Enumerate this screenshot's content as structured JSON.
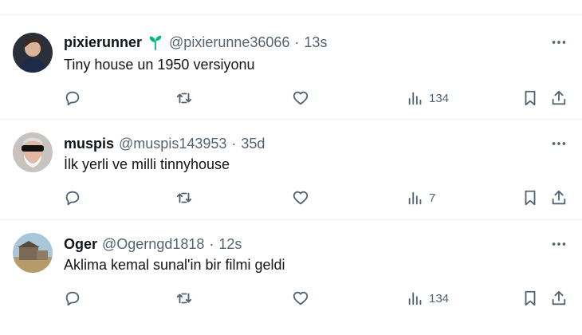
{
  "tweets": [
    {
      "name": "pixierunner",
      "handle": "@pixierunne36066",
      "separator": "·",
      "time": "13s",
      "text": "Tiny house un 1950 versiyonu",
      "views": "134",
      "has_badge": true,
      "badge_icon": "sprout-icon"
    },
    {
      "name": "muspis",
      "handle": "@muspis143953",
      "separator": "·",
      "time": "35d",
      "text": "İlk yerli ve milli tinnyhouse",
      "views": "7"
    },
    {
      "name": "Oger",
      "handle": "@Ogerngd1818",
      "separator": "·",
      "time": "12s",
      "text": "Aklima kemal sunal'in bir filmi geldi",
      "views": "134"
    }
  ],
  "icons": {
    "reply": "reply-icon",
    "retweet": "retweet-icon",
    "like": "heart-icon",
    "views": "views-icon",
    "bookmark": "bookmark-icon",
    "share": "share-icon",
    "more": "more-icon"
  },
  "colors": {
    "text": "#0f1419",
    "secondary": "#536471",
    "divider": "#eff3f4",
    "badge": "#00ba7c"
  }
}
